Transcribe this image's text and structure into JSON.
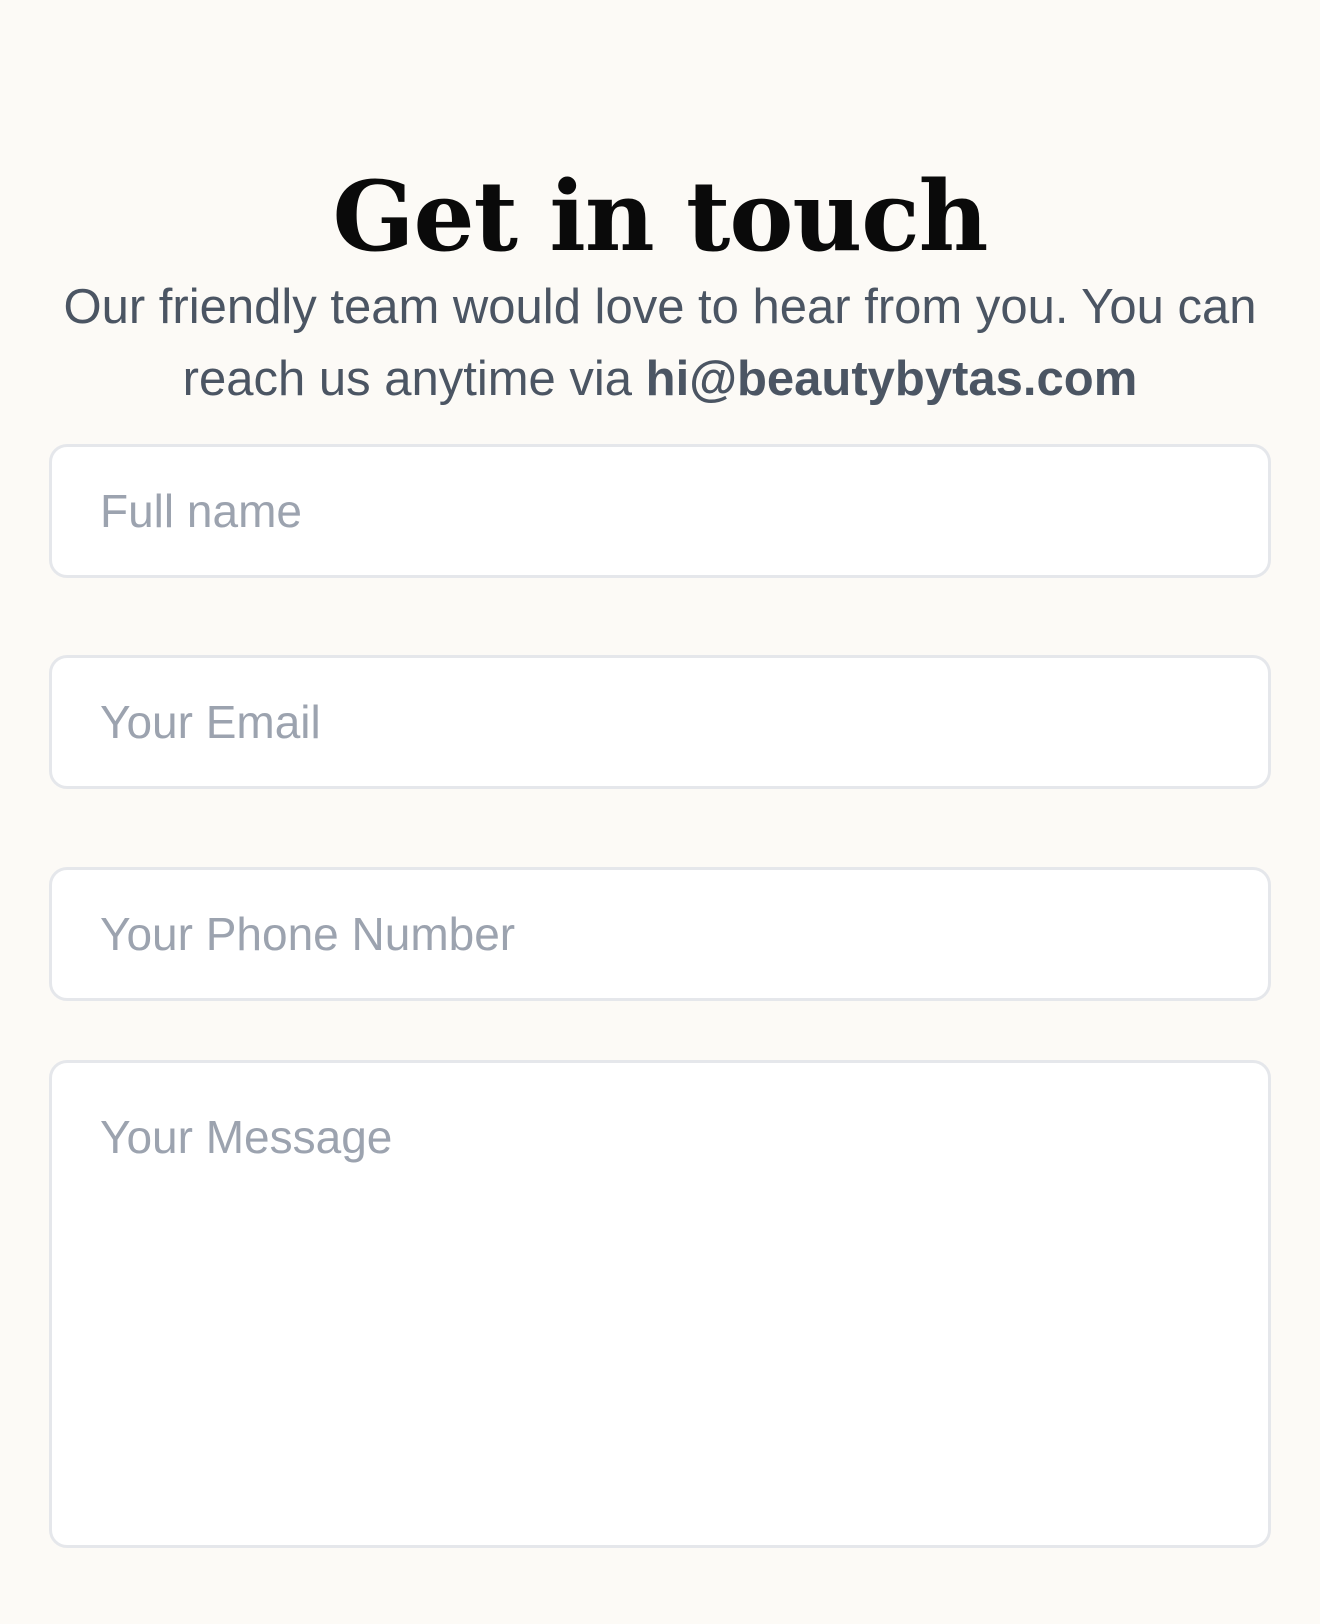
{
  "header": {
    "title": "Get in touch",
    "subtitle_text": "Our friendly team would love to hear from you. You can reach us anytime via ",
    "contact_email": "hi@beautybytas.com"
  },
  "form": {
    "full_name": {
      "placeholder": "Full name",
      "value": ""
    },
    "email": {
      "placeholder": "Your Email",
      "value": ""
    },
    "phone": {
      "placeholder": "Your Phone Number",
      "value": ""
    },
    "message": {
      "placeholder": "Your Message",
      "value": ""
    }
  },
  "colors": {
    "background": "#fcfaf6",
    "title": "#0a0a0a",
    "subtitle": "#4b5563",
    "field_border": "#e5e7eb",
    "placeholder": "#9ca3af"
  }
}
